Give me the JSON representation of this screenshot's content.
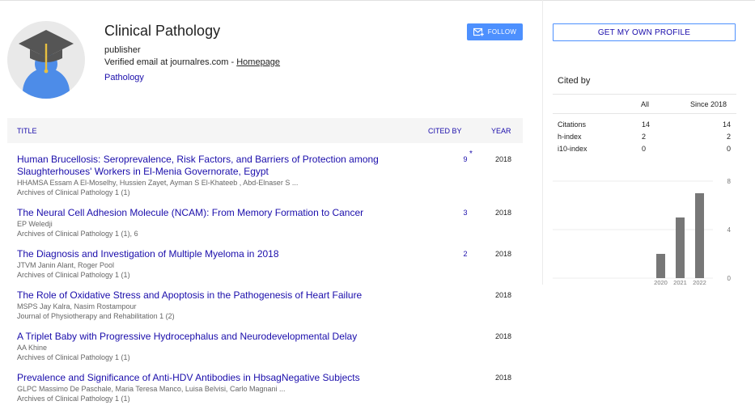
{
  "profile": {
    "name": "Clinical Pathology",
    "affiliation": "publisher",
    "verified_text": "Verified email at journalres.com - ",
    "homepage_label": "Homepage",
    "interest": "Pathology",
    "follow_label": "FOLLOW"
  },
  "table": {
    "col_title": "TITLE",
    "col_cited": "CITED BY",
    "col_year": "YEAR",
    "rows": [
      {
        "title": "Human Brucellosis: Seroprevalence, Risk Factors, and Barriers of Protection among Slaughterhouses' Workers in El-Menia Governorate, Egypt",
        "authors": "HHAMSA Essam A El-Moselhy, Hussien Zayet, Ayman S El-Khateeb , Abd-Elnaser S ...",
        "venue": "Archives of Clinical Pathology 1 (1)",
        "cited": "9",
        "star": "*",
        "year": "2018"
      },
      {
        "title": "The Neural Cell Adhesion Molecule (NCAM): From Memory Formation to Cancer",
        "authors": "EP Weledji",
        "venue": "Archives of Clinical Pathology 1 (1), 6",
        "cited": "3",
        "star": "",
        "year": "2018"
      },
      {
        "title": "The Diagnosis and Investigation of Multiple Myeloma in 2018",
        "authors": "JTVM Janin Alant, Roger Pool",
        "venue": "Archives of Clinical Pathology 1 (1)",
        "cited": "2",
        "star": "",
        "year": "2018"
      },
      {
        "title": "The Role of Oxidative Stress and Apoptosis in the Pathogenesis of Heart Failure",
        "authors": "MSPS Jay Kalra, Nasim Rostampour",
        "venue": "Journal of Physiotherapy and Rehabilitation 1 (2)",
        "cited": "",
        "star": "",
        "year": "2018"
      },
      {
        "title": "A Triplet Baby with Progressive Hydrocephalus and Neurodevelopmental Delay",
        "authors": "AA Khine",
        "venue": "Archives of Clinical Pathology 1 (1)",
        "cited": "",
        "star": "",
        "year": "2018"
      },
      {
        "title": "Prevalence and Significance of Anti-HDV Antibodies in HbsagNegative Subjects",
        "authors": "GLPC Massimo De Paschale, Maria Teresa Manco, Luisa Belvisi, Carlo Magnani ...",
        "venue": "Archives of Clinical Pathology 1 (1)",
        "cited": "",
        "star": "",
        "year": "2018"
      }
    ]
  },
  "sidebar": {
    "get_profile_label": "GET MY OWN PROFILE",
    "cited_by_title": "Cited by",
    "col_all": "All",
    "col_since": "Since 2018",
    "metrics": [
      {
        "label": "Citations",
        "all": "14",
        "since": "14"
      },
      {
        "label": "h-index",
        "all": "2",
        "since": "2"
      },
      {
        "label": "i10-index",
        "all": "0",
        "since": "0"
      }
    ]
  },
  "colors": {
    "link": "#1a0dab",
    "accent": "#4d90fe",
    "bar": "#777777"
  },
  "icons": {
    "avatar": "graduation-cap-avatar-icon",
    "follow": "email-plus-icon"
  },
  "chart_data": {
    "type": "bar",
    "categories": [
      "2020",
      "2021",
      "2022"
    ],
    "values": [
      2,
      5,
      7
    ],
    "ylim": [
      0,
      8
    ],
    "yticks": [
      "0",
      "4",
      "8"
    ],
    "title": "",
    "xlabel": "",
    "ylabel": "",
    "grid": true
  }
}
